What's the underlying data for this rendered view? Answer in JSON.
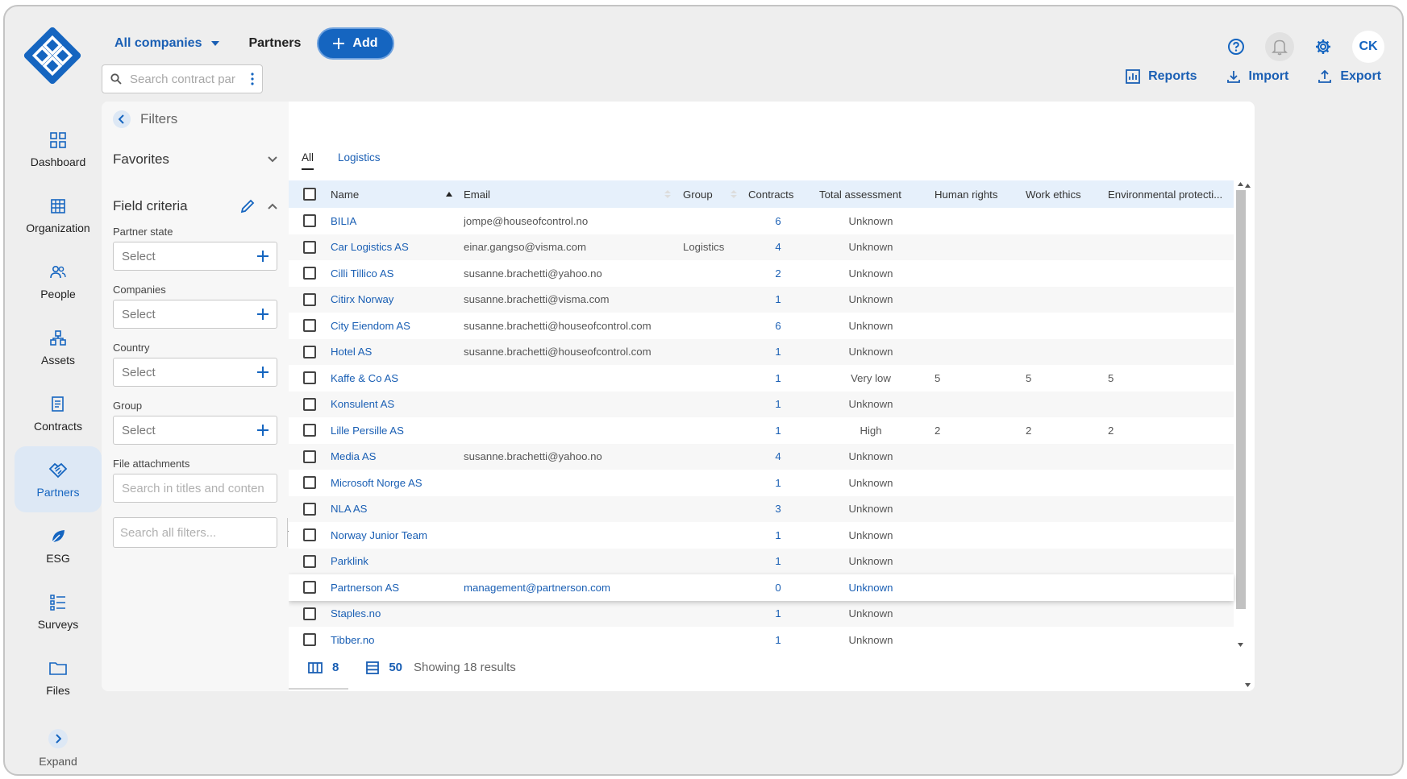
{
  "header": {
    "company_selector": "All companies",
    "page_title": "Partners",
    "add_label": "Add",
    "user_initials": "CK",
    "search_placeholder": "Search contract par"
  },
  "actions": {
    "reports": "Reports",
    "import": "Import",
    "export": "Export"
  },
  "sidebar": {
    "items": [
      {
        "label": "Dashboard",
        "icon": "dashboard-icon"
      },
      {
        "label": "Organization",
        "icon": "organization-icon"
      },
      {
        "label": "People",
        "icon": "people-icon"
      },
      {
        "label": "Assets",
        "icon": "assets-icon"
      },
      {
        "label": "Contracts",
        "icon": "contracts-icon"
      },
      {
        "label": "Partners",
        "icon": "handshake-icon",
        "active": true
      },
      {
        "label": "ESG",
        "icon": "leaf-icon"
      },
      {
        "label": "Surveys",
        "icon": "surveys-icon"
      },
      {
        "label": "Files",
        "icon": "folder-icon"
      }
    ],
    "expand_label": "Expand"
  },
  "filters": {
    "title": "Filters",
    "favorites": "Favorites",
    "field_criteria": "Field criteria",
    "fields": [
      {
        "label": "Partner state",
        "value": "Select"
      },
      {
        "label": "Companies",
        "value": "Select"
      },
      {
        "label": "Country",
        "value": "Select"
      },
      {
        "label": "Group",
        "value": "Select"
      }
    ],
    "file_attachments_label": "File attachments",
    "file_attachments_placeholder": "Search in titles and conten",
    "search_all_placeholder": "Search all filters..."
  },
  "tabs": [
    {
      "label": "All",
      "active": true
    },
    {
      "label": "Logistics",
      "active": false
    }
  ],
  "table": {
    "columns": [
      "Name",
      "Email",
      "Group",
      "Contracts",
      "Total assessment",
      "Human rights",
      "Work ethics",
      "Environmental protecti..."
    ],
    "rows": [
      {
        "name": "BILIA",
        "email": "jompe@houseofcontrol.no",
        "group": "",
        "contracts": "6",
        "total": "Unknown",
        "hr": "",
        "we": "",
        "ep": ""
      },
      {
        "name": "Car Logistics AS",
        "email": "einar.gangso@visma.com",
        "group": "Logistics",
        "contracts": "4",
        "total": "Unknown",
        "hr": "",
        "we": "",
        "ep": ""
      },
      {
        "name": "Cilli Tillico AS",
        "email": "susanne.brachetti@yahoo.no",
        "group": "",
        "contracts": "2",
        "total": "Unknown",
        "hr": "",
        "we": "",
        "ep": ""
      },
      {
        "name": "Citirx Norway",
        "email": "susanne.brachetti@visma.com",
        "group": "",
        "contracts": "1",
        "total": "Unknown",
        "hr": "",
        "we": "",
        "ep": ""
      },
      {
        "name": "City Eiendom AS",
        "email": "susanne.brachetti@houseofcontrol.com",
        "group": "",
        "contracts": "6",
        "total": "Unknown",
        "hr": "",
        "we": "",
        "ep": ""
      },
      {
        "name": "Hotel AS",
        "email": "susanne.brachetti@houseofcontrol.com",
        "group": "",
        "contracts": "1",
        "total": "Unknown",
        "hr": "",
        "we": "",
        "ep": ""
      },
      {
        "name": "Kaffe & Co AS",
        "email": "",
        "group": "",
        "contracts": "1",
        "total": "Very low",
        "hr": "5",
        "we": "5",
        "ep": "5"
      },
      {
        "name": "Konsulent AS",
        "email": "",
        "group": "",
        "contracts": "1",
        "total": "Unknown",
        "hr": "",
        "we": "",
        "ep": ""
      },
      {
        "name": "Lille Persille AS",
        "email": "",
        "group": "",
        "contracts": "1",
        "total": "High",
        "hr": "2",
        "we": "2",
        "ep": "2"
      },
      {
        "name": "Media AS",
        "email": "susanne.brachetti@yahoo.no",
        "group": "",
        "contracts": "4",
        "total": "Unknown",
        "hr": "",
        "we": "",
        "ep": ""
      },
      {
        "name": "Microsoft Norge AS",
        "email": "",
        "group": "",
        "contracts": "1",
        "total": "Unknown",
        "hr": "",
        "we": "",
        "ep": ""
      },
      {
        "name": "NLA AS",
        "email": "",
        "group": "",
        "contracts": "3",
        "total": "Unknown",
        "hr": "",
        "we": "",
        "ep": ""
      },
      {
        "name": "Norway Junior Team",
        "email": "",
        "group": "",
        "contracts": "1",
        "total": "Unknown",
        "hr": "",
        "we": "",
        "ep": ""
      },
      {
        "name": "Parklink",
        "email": "",
        "group": "",
        "contracts": "1",
        "total": "Unknown",
        "hr": "",
        "we": "",
        "ep": ""
      },
      {
        "name": "Partnerson AS",
        "email": "management@partnerson.com",
        "group": "",
        "contracts": "0",
        "total": "Unknown",
        "hr": "",
        "we": "",
        "ep": "",
        "highlighted": true
      },
      {
        "name": "Staples.no",
        "email": "",
        "group": "",
        "contracts": "1",
        "total": "Unknown",
        "hr": "",
        "we": "",
        "ep": ""
      },
      {
        "name": "Tibber.no",
        "email": "",
        "group": "",
        "contracts": "1",
        "total": "Unknown",
        "hr": "",
        "we": "",
        "ep": ""
      }
    ]
  },
  "footer": {
    "columns_count": "8",
    "page_size": "50",
    "showing": "Showing 18 results"
  },
  "colors": {
    "accent": "#1565c0",
    "link": "#1a5fb4",
    "header_row": "#e6f0fb",
    "active_nav": "#dde8f5"
  }
}
